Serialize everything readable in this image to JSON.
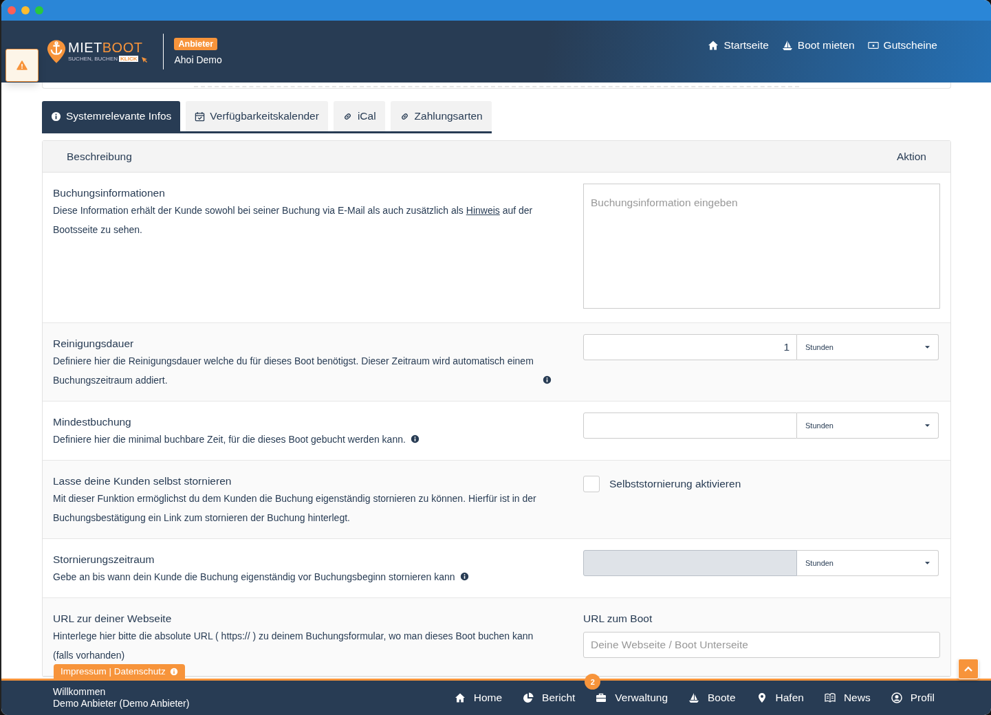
{
  "header": {
    "logo": {
      "word_1": "MIET",
      "word_2": "BOOT",
      "tagline": "SUCHEN, BUCHEN",
      "klick": "KLICK"
    },
    "role_badge": "Anbieter",
    "account_name": "Ahoi Demo",
    "nav": [
      {
        "label": "Startseite"
      },
      {
        "label": "Boot mieten"
      },
      {
        "label": "Gutscheine"
      }
    ]
  },
  "tabs": [
    {
      "label": "Systemrelevante Infos",
      "selected": true
    },
    {
      "label": "Verfügbarkeitskalender",
      "selected": false
    },
    {
      "label": "iCal",
      "selected": false
    },
    {
      "label": "Zahlungsarten",
      "selected": false
    }
  ],
  "table": {
    "columns": [
      "Beschreibung",
      "Aktion"
    ],
    "rows": [
      {
        "kind": "textarea",
        "title": "Buchungsinformationen",
        "description": "Diese Information erhält der Kunde sowohl bei seiner Buchung via E-Mail als auch zusätzlich als",
        "link": "Hinweis",
        "description_after": "auf der Bootsseite zu sehen.",
        "placeholder": "Buchungsinformation eingeben"
      },
      {
        "kind": "duration",
        "title": "Reinigungsdauer",
        "description": "Definiere hier die Reinigungsdauer welche du für dieses Boot benötigst. Dieser Zeitraum wird automatisch einem Buchungszeitraum addiert.",
        "info_icon": true,
        "value": "1",
        "unit": "Stunden",
        "disabled": false
      },
      {
        "kind": "duration",
        "title": "Mindestbuchung",
        "description": "Definiere hier die minimal buchbare Zeit, für die dieses Boot gebucht werden kann.",
        "info_icon": true,
        "unit": "Stunden",
        "disabled": false
      },
      {
        "kind": "checkbox",
        "title": "Lasse deine Kunden selbst stornieren",
        "description": "Mit dieser Funktion ermöglichst du dem Kunden die Buchung eigenständig stornieren zu können. Hierfür ist in der Buchungsbestätigung ein Link zum stornieren der Buchung hinterlegt.",
        "checkbox_label": "Selbststornierung aktivieren",
        "checked": false
      },
      {
        "kind": "duration",
        "title": "Stornierungszeitraum",
        "description": "Gebe an bis wann dein Kunde die Buchung eigenständig vor Buchungsbeginn stornieren kann",
        "info_icon": true,
        "unit": "Stunden",
        "disabled": true
      },
      {
        "kind": "url",
        "title": "URL zur deiner Webseite",
        "description": "Hinterlege hier bitte die absolute URL ( https:// ) zu deinem Buchungsformular, wo man dieses Boot buchen kann (falls vorhanden)",
        "field_label": "URL zum Boot",
        "placeholder": "Deine Webseite / Boot Unterseite"
      }
    ]
  },
  "footer": {
    "legal_tab": "Impressum | Datenschutz",
    "greeting": "Willkommen",
    "user": "Demo Anbieter (Demo Anbieter)",
    "nav": [
      {
        "label": "Home"
      },
      {
        "label": "Bericht"
      },
      {
        "label": "Verwaltung",
        "badge": "2"
      },
      {
        "label": "Boote"
      },
      {
        "label": "Hafen"
      },
      {
        "label": "News"
      },
      {
        "label": "Profil"
      }
    ]
  }
}
